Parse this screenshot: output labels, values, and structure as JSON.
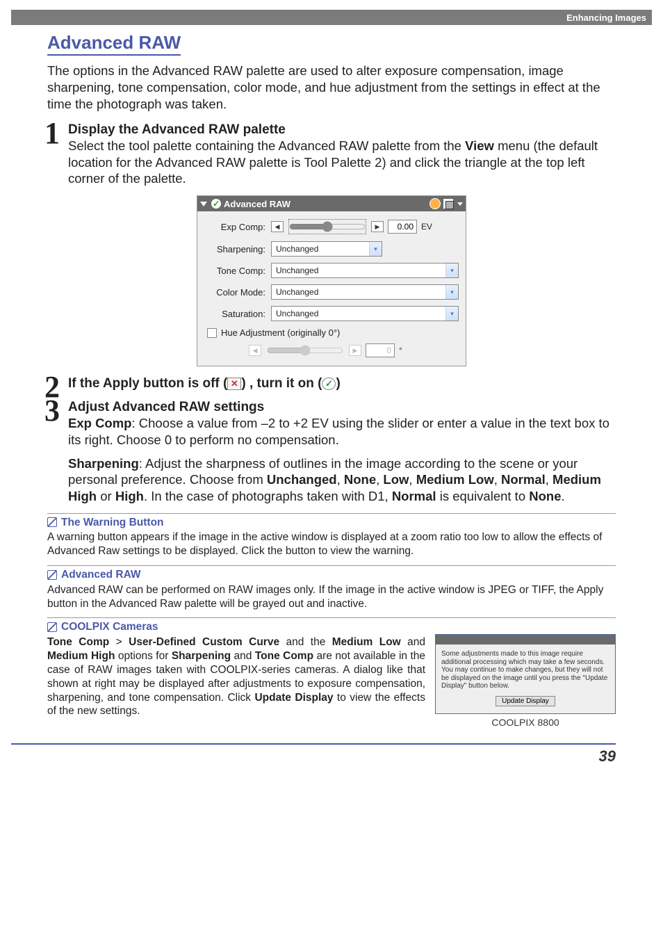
{
  "header": {
    "section": "Enhancing Images"
  },
  "title": "Advanced RAW",
  "intro": "The options in the Advanced RAW palette are used to alter exposure compensation, image sharpening, tone compensation, color mode, and hue adjustment from the settings in effect at the time the photograph was taken.",
  "steps": {
    "s1": {
      "num": "1",
      "title": "Display the Advanced RAW palette",
      "body_pre": "Select the tool palette containing the Advanced RAW palette from the ",
      "body_bold1": "View",
      "body_post": " menu (the default location for the Advanced RAW palette is Tool Palette 2) and click the triangle at the top left corner of the palette."
    },
    "s2": {
      "num": "2",
      "title_pre": "If the Apply button is off (",
      "title_mid": ") , turn it on (",
      "title_post": ")"
    },
    "s3": {
      "num": "3",
      "title": "Adjust Advanced RAW settings",
      "p1_b": "Exp Comp",
      "p1": ": Choose a value from –2 to +2 EV using the slider or enter a value in the text box to its right.  Choose 0 to perform no compensation.",
      "p2_b": "Sharpening",
      "p2_pre": ": Adjust the sharpness of outlines in the image according to the scene or your personal preference.  Choose from ",
      "p2_list": [
        "Unchanged",
        "None",
        "Low",
        "Medium Low",
        "Normal",
        "Medium High",
        "High"
      ],
      "p2_post1": ".   In the case of photographs taken with D1, ",
      "p2_post2": " is equivalent to ",
      "p2_post3": "."
    }
  },
  "palette": {
    "title": "Advanced RAW",
    "expcomp_label": "Exp Comp:",
    "expcomp_value": "0.00",
    "expcomp_unit": "EV",
    "sharpening_label": "Sharpening:",
    "sharpening_value": "Unchanged",
    "tonecomp_label": "Tone Comp:",
    "tonecomp_value": "Unchanged",
    "colormode_label": "Color Mode:",
    "colormode_value": "Unchanged",
    "saturation_label": "Saturation:",
    "saturation_value": "Unchanged",
    "hue_label": "Hue Adjustment (originally 0°)",
    "hue_value": "0",
    "hue_unit": "°"
  },
  "notes": {
    "warn": {
      "title": "The Warning Button",
      "body": "A warning button appears if the image in the active window is displayed at a zoom ratio too low to allow the effects of Advanced Raw settings to be displayed.  Click the button to view the warning."
    },
    "adv": {
      "title": "Advanced RAW",
      "body": "Advanced RAW can be performed on RAW images only.  If the image in the active window is JPEG or TIFF, the Apply button in the Advanced Raw palette will be grayed out and inactive."
    },
    "coolpix": {
      "title": " COOLPIX Cameras",
      "b1": "Tone Comp",
      "gt": " > ",
      "b2": "User-Defined Custom Curve",
      "mid1": " and the ",
      "b3": "Medium Low",
      "mid2": " and ",
      "b4": "Medium High",
      "mid3": " options for ",
      "b5": "Sharpening",
      "mid4": " and ",
      "b6": "Tone Comp",
      "post": " are not available in the case of RAW images taken with COOLPIX-series cameras.  A dialog like that shown at right may be displayed after adjustments to exposure compensation, sharpening, and tone compensation.  Click ",
      "b7": "Update Display",
      "post2": " to view the effects of the new settings."
    }
  },
  "dialog": {
    "msg": "Some adjustments made to this image require additional processing which may take a few seconds.  You may continue to make changes, but they will not be displayed on the image until you press the \"Update Display\" button below.",
    "btn": "Update Display",
    "caption": "COOLPIX 8800"
  },
  "page_number": "39"
}
